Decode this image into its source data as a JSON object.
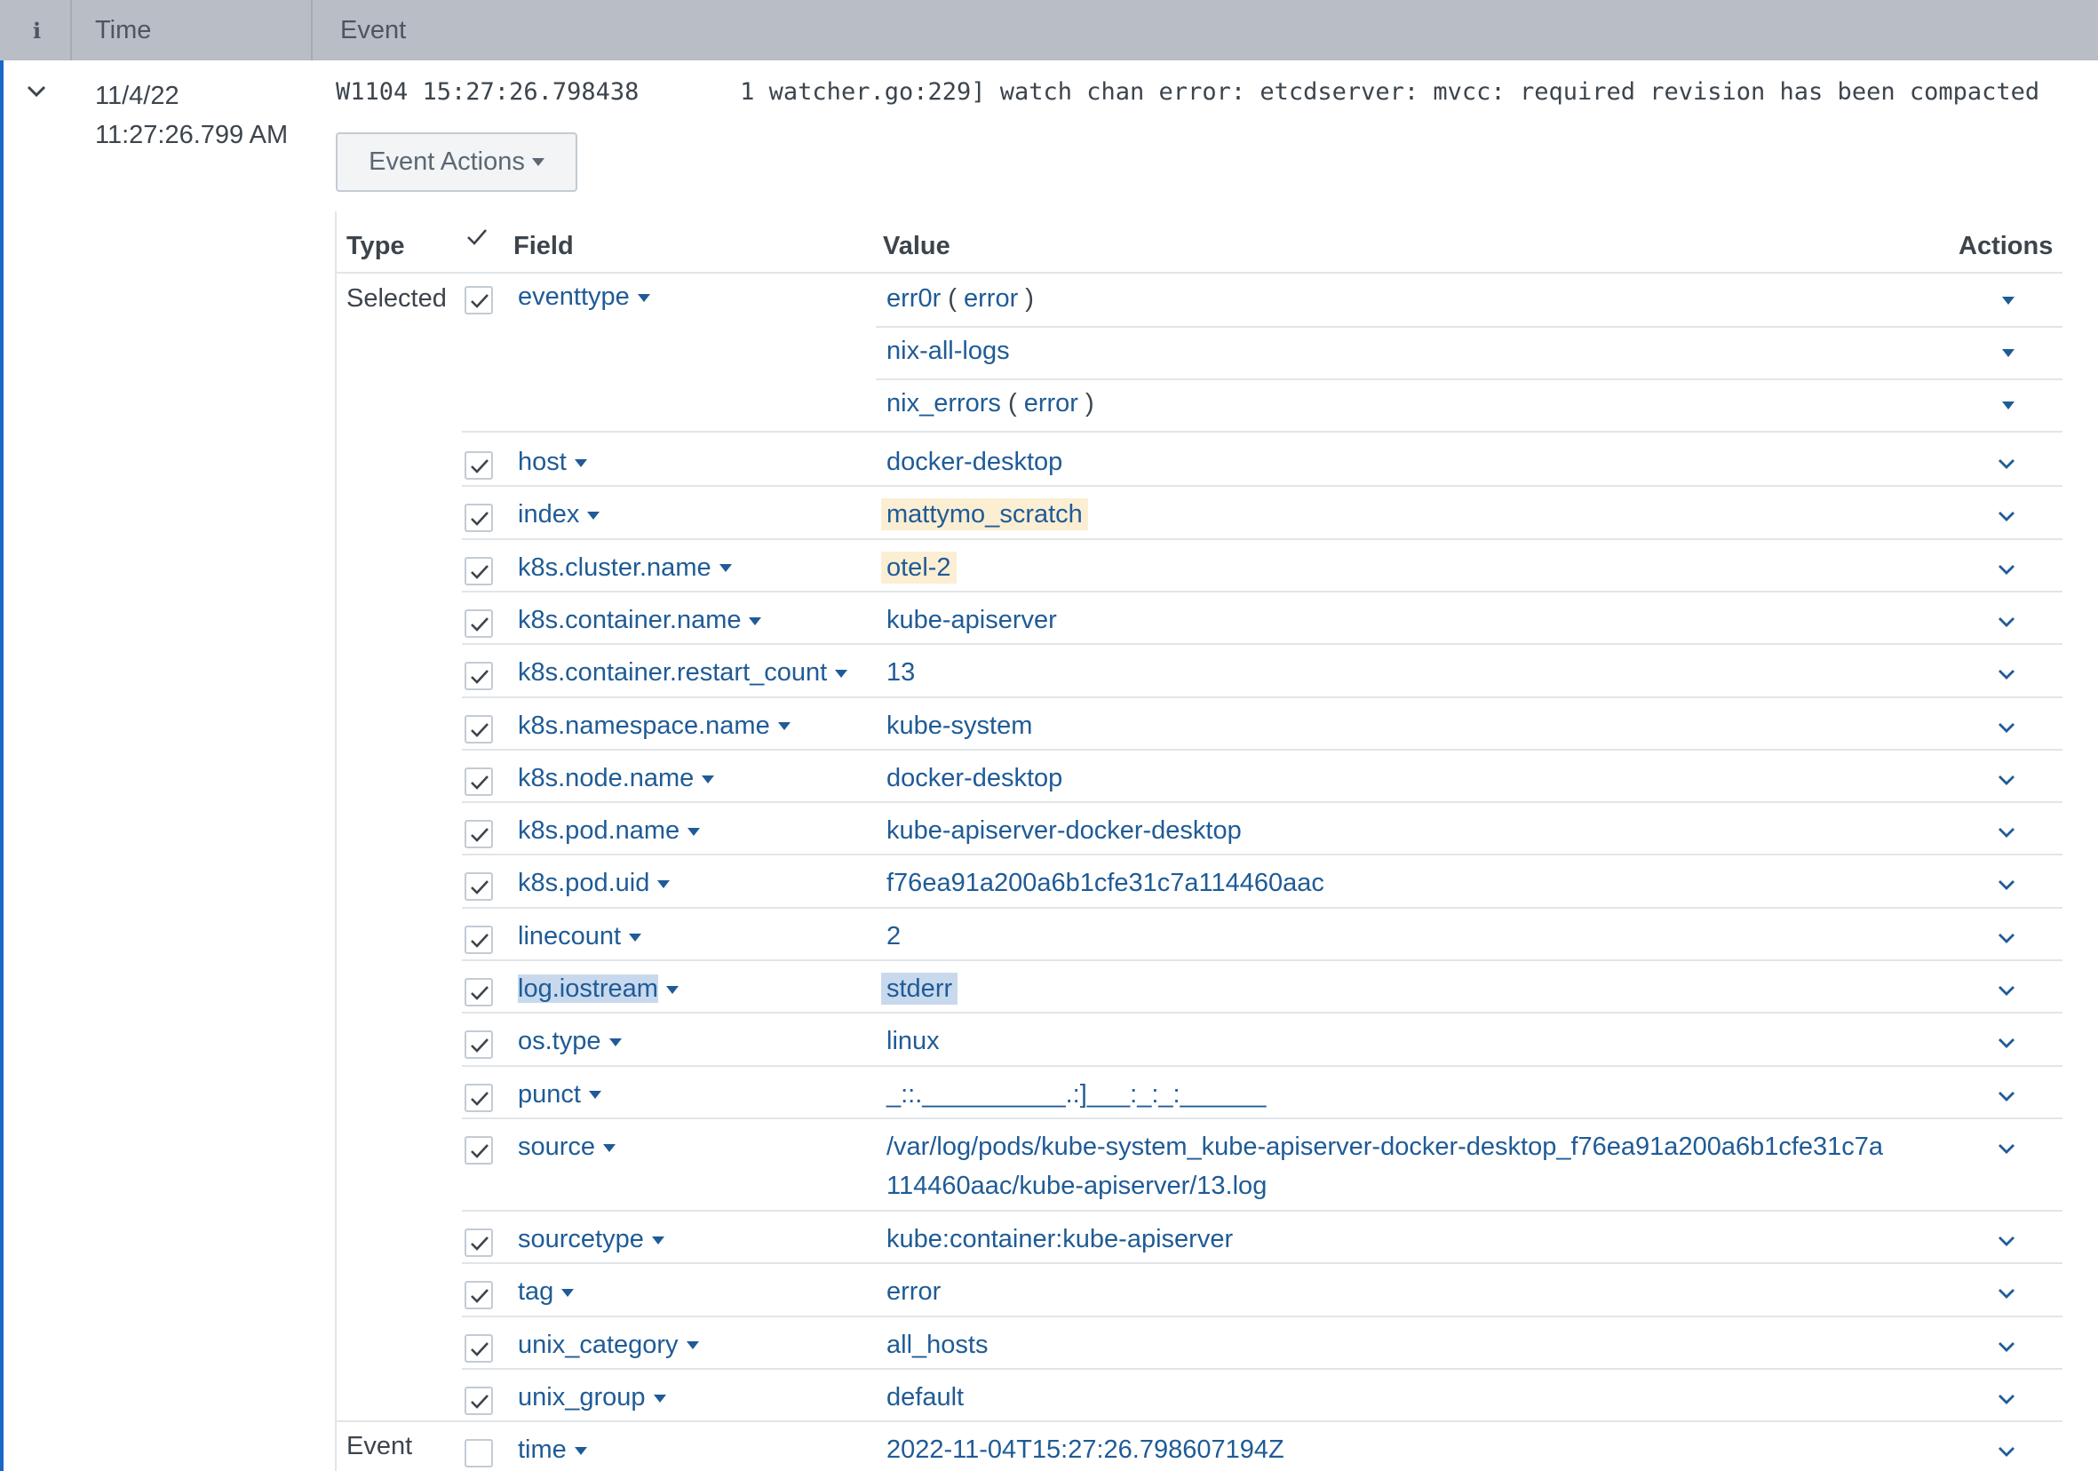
{
  "header": {
    "info": "i",
    "time": "Time",
    "event": "Event"
  },
  "event": {
    "date": "11/4/22",
    "time": "11:27:26.799 AM",
    "raw": "W1104 15:27:26.798438       1 watcher.go:229] watch chan error: etcdserver: mvcc: required revision has been compacted",
    "actions_label": "Event Actions"
  },
  "table": {
    "headers": {
      "type": "Type",
      "field": "Field",
      "value": "Value",
      "actions": "Actions"
    }
  },
  "type_labels": {
    "selected": "Selected",
    "event": "Event"
  },
  "eventtype": {
    "field": "eventtype",
    "values": [
      {
        "name": "err0r",
        "paren_open": " ( ",
        "tag": "error",
        "paren_close": " )"
      },
      {
        "name": "nix-all-logs"
      },
      {
        "name": "nix_errors",
        "paren_open": " ( ",
        "tag": "error",
        "paren_close": " )"
      }
    ]
  },
  "fields": [
    {
      "field": "host",
      "value": "docker-desktop",
      "checked": true
    },
    {
      "field": "index",
      "value": "mattymo_scratch",
      "checked": true
    },
    {
      "field": "k8s.cluster.name",
      "value": "otel-2",
      "checked": true
    },
    {
      "field": "k8s.container.name",
      "value": "kube-apiserver",
      "checked": true
    },
    {
      "field": "k8s.container.restart_count",
      "value": "13",
      "checked": true
    },
    {
      "field": "k8s.namespace.name",
      "value": "kube-system",
      "checked": true
    },
    {
      "field": "k8s.node.name",
      "value": "docker-desktop",
      "checked": true
    },
    {
      "field": "k8s.pod.name",
      "value": "kube-apiserver-docker-desktop",
      "checked": true
    },
    {
      "field": "k8s.pod.uid",
      "value": "f76ea91a200a6b1cfe31c7a114460aac",
      "checked": true
    },
    {
      "field": "linecount",
      "value": "2",
      "checked": true
    },
    {
      "field": "log.iostream",
      "value": "stderr",
      "checked": true
    },
    {
      "field": "os.type",
      "value": "linux",
      "checked": true
    },
    {
      "field": "punct",
      "value": "_::.__________.:]___:_:_:______",
      "checked": true
    },
    {
      "field": "source",
      "value": "/var/log/pods/kube-system_kube-apiserver-docker-desktop_f76ea91a200a6b1cfe31c7a",
      "value_line2": "114460aac/kube-apiserver/13.log",
      "checked": true
    },
    {
      "field": "sourcetype",
      "value": "kube:container:kube-apiserver",
      "checked": true
    },
    {
      "field": "tag",
      "value": "error",
      "checked": true
    },
    {
      "field": "unix_category",
      "value": "all_hosts",
      "checked": true
    },
    {
      "field": "unix_group",
      "value": "default",
      "checked": true
    },
    {
      "field": "time",
      "value": "2022-11-04T15:27:26.798607194Z",
      "checked": false
    }
  ]
}
